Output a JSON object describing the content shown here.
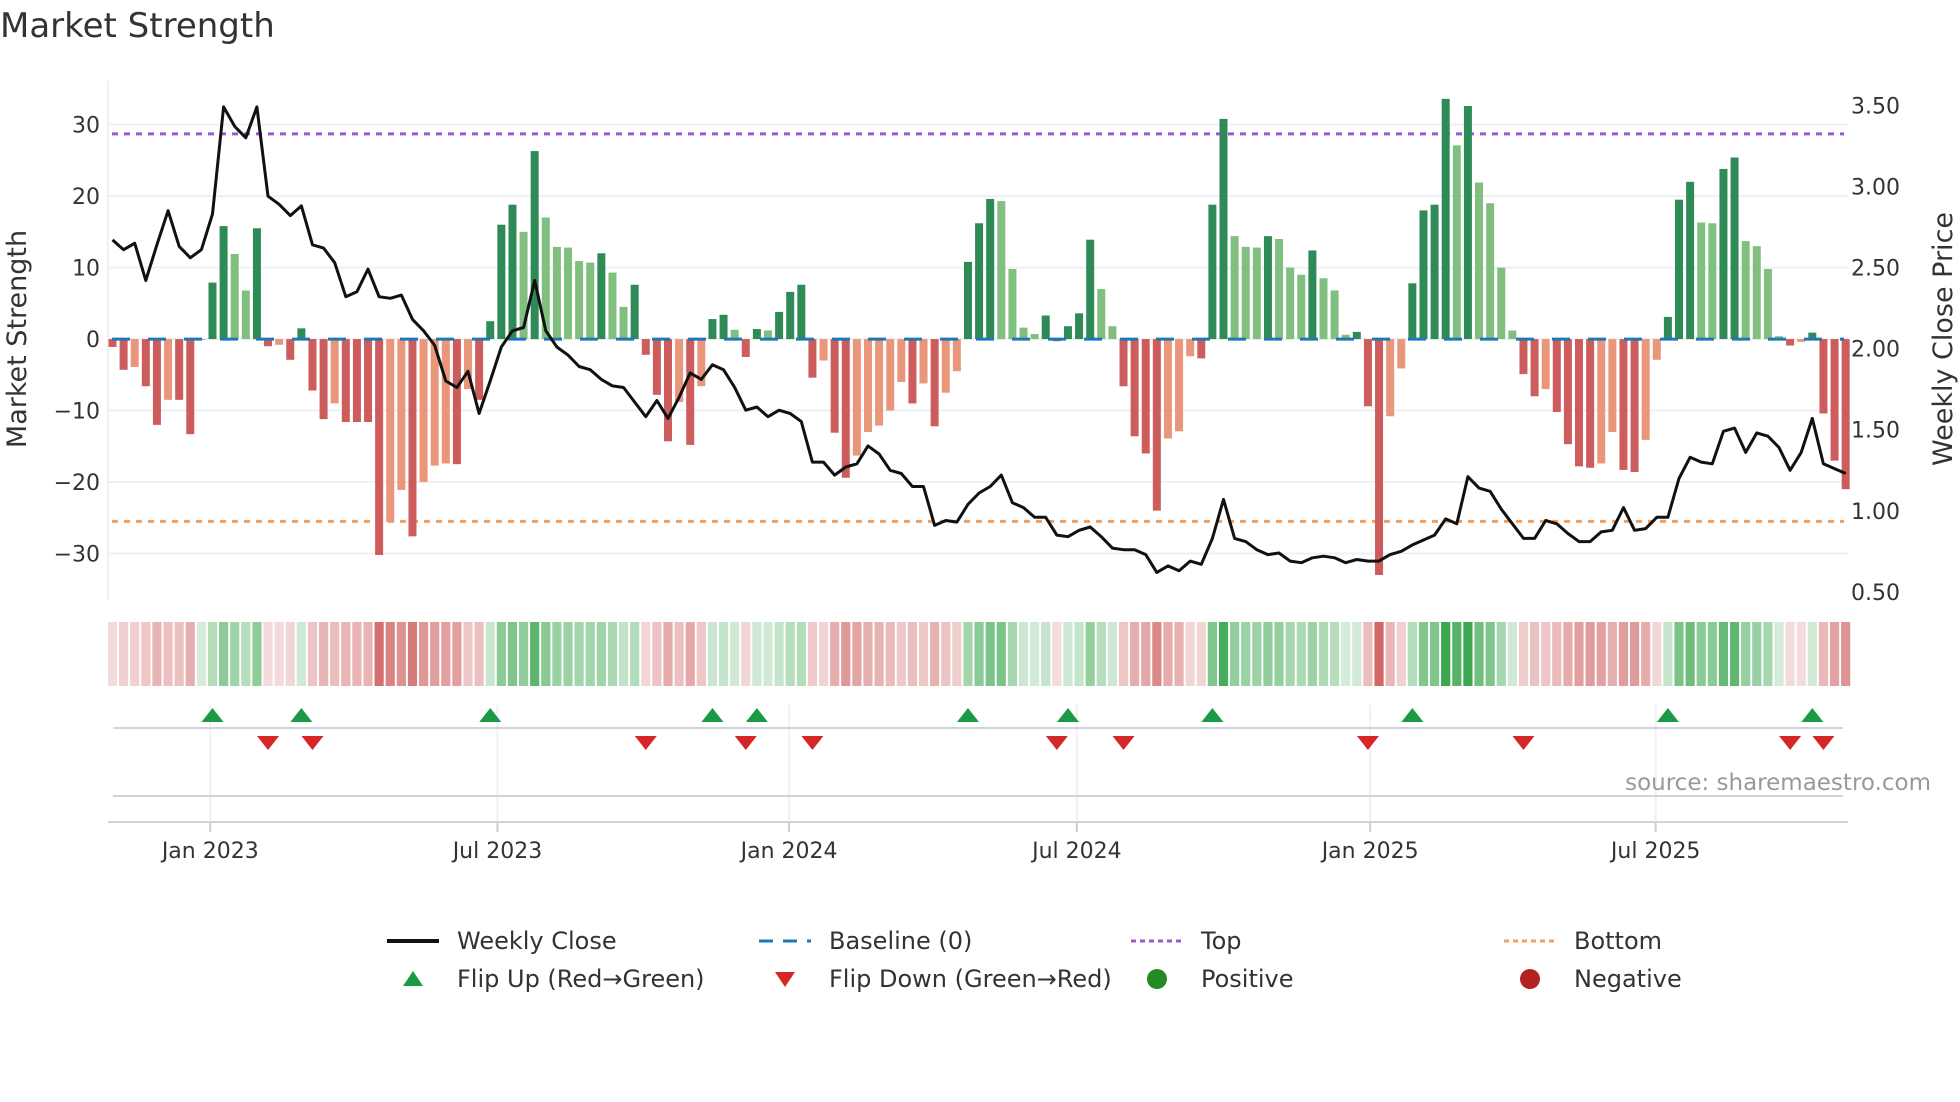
{
  "title": "Market Strength",
  "source": "source: sharemaestro.com",
  "colors": {
    "pos_dark": "#2e8b57",
    "pos_light": "#80bf80",
    "neg_dark": "#cd5c5c",
    "neg_light": "#e9967a",
    "baseline": "#1f77b4",
    "top": "#9b59d0",
    "bottom": "#f0a060",
    "close": "#111111",
    "flip_up": "#1a9a45",
    "flip_down": "#d62728",
    "positive": "#228b22",
    "negative": "#b22222",
    "heat_pos": "46,160,67",
    "heat_neg": "205,92,92"
  },
  "chart_data": {
    "type": "bar+line",
    "title": "Market Strength",
    "ylabel": "Market Strength",
    "y2label": "Weekly Close Price",
    "ylim": [
      -36.5,
      36.1
    ],
    "y2lim": [
      0.45,
      3.65
    ],
    "yticks": [
      "30",
      "20",
      "10",
      "0",
      "−10",
      "−20",
      "−30"
    ],
    "ytick_values": [
      30,
      20,
      10,
      0,
      -10,
      -20,
      -30
    ],
    "y2ticks": [
      "3.50",
      "3.00",
      "2.50",
      "2.00",
      "1.50",
      "1.00",
      "0.50"
    ],
    "y2tick_values": [
      3.5,
      3.0,
      2.5,
      2.0,
      1.5,
      1.0,
      0.5
    ],
    "xticks": [
      {
        "label": "Jan 2023",
        "week": 8.8
      },
      {
        "label": "Jul 2023",
        "week": 34.65
      },
      {
        "label": "Jan 2024",
        "week": 60.9
      },
      {
        "label": "Jul 2024",
        "week": 86.8
      },
      {
        "label": "Jan 2025",
        "week": 113.2
      },
      {
        "label": "Jul 2025",
        "week": 138.9
      }
    ],
    "top_line": 28.7,
    "bottom_line": -25.5,
    "baseline": 0,
    "strength": [
      -1.1,
      -4.3,
      -3.9,
      -6.6,
      -12,
      -8.5,
      -8.5,
      -13.3,
      0,
      7.9,
      15.8,
      11.9,
      6.8,
      15.5,
      -1,
      -0.8,
      -2.9,
      1.5,
      -7.2,
      -11.2,
      -9,
      -11.6,
      -11.6,
      -11.6,
      -30.2,
      -25.6,
      -21.1,
      -27.6,
      -20,
      -17.7,
      -17.4,
      -17.5,
      -7,
      -8.5,
      2.5,
      16,
      18.8,
      15,
      26.3,
      17,
      12.9,
      12.8,
      10.9,
      10.7,
      12,
      9.3,
      4.5,
      7.6,
      -2.2,
      -7.8,
      -14.3,
      -8.8,
      -14.8,
      -6.6,
      2.8,
      3.4,
      1.3,
      -2.5,
      1.4,
      1.2,
      3.8,
      6.6,
      7.6,
      -5.4,
      -3,
      -13.1,
      -19.4,
      -16.3,
      -13,
      -12.1,
      -10,
      -6,
      -9,
      -6.2,
      -12.2,
      -7.5,
      -4.5,
      10.8,
      16.2,
      19.6,
      19.3,
      9.8,
      1.6,
      0.7,
      3.3,
      -0.3,
      1.8,
      3.6,
      13.9,
      7,
      1.8,
      -6.6,
      -13.6,
      -16,
      -24,
      -13.9,
      -12.9,
      -2.4,
      -2.7,
      18.8,
      30.8,
      14.4,
      12.9,
      12.8,
      14.4,
      14,
      10,
      9,
      12.4,
      8.5,
      6.8,
      0.6,
      1,
      -9.4,
      -33,
      -10.8,
      -4.1,
      7.8,
      18,
      18.8,
      33.6,
      27.1,
      32.6,
      21.9,
      19,
      10,
      1.2,
      -4.9,
      -8,
      -7,
      -10.2,
      -14.7,
      -17.8,
      -18,
      -17.4,
      -13,
      -18.3,
      -18.6,
      -14.1,
      -2.9,
      3.1,
      19.5,
      22,
      16.3,
      16.2,
      23.8,
      25.4,
      13.7,
      13,
      9.8,
      0.4,
      -0.9,
      -0.4,
      0.9,
      -10.4,
      -17,
      -21
    ],
    "close": [
      2.67,
      2.61,
      2.65,
      2.42,
      2.64,
      2.85,
      2.63,
      2.56,
      2.61,
      2.83,
      3.49,
      3.37,
      3.3,
      3.49,
      2.94,
      2.89,
      2.82,
      2.88,
      2.64,
      2.62,
      2.53,
      2.32,
      2.35,
      2.49,
      2.32,
      2.31,
      2.33,
      2.18,
      2.11,
      2.02,
      1.8,
      1.76,
      1.86,
      1.6,
      1.8,
      2.01,
      2.11,
      2.13,
      2.42,
      2.11,
      2.01,
      1.96,
      1.89,
      1.87,
      1.81,
      1.77,
      1.76,
      1.67,
      1.58,
      1.68,
      1.57,
      1.7,
      1.85,
      1.81,
      1.9,
      1.87,
      1.76,
      1.62,
      1.64,
      1.58,
      1.62,
      1.6,
      1.55,
      1.3,
      1.3,
      1.22,
      1.27,
      1.29,
      1.4,
      1.35,
      1.25,
      1.23,
      1.15,
      1.15,
      0.91,
      0.94,
      0.93,
      1.04,
      1.11,
      1.15,
      1.22,
      1.05,
      1.02,
      0.96,
      0.96,
      0.85,
      0.84,
      0.88,
      0.9,
      0.84,
      0.77,
      0.76,
      0.76,
      0.73,
      0.62,
      0.66,
      0.63,
      0.69,
      0.67,
      0.83,
      1.07,
      0.83,
      0.81,
      0.76,
      0.73,
      0.74,
      0.69,
      0.68,
      0.71,
      0.72,
      0.71,
      0.68,
      0.7,
      0.69,
      0.69,
      0.73,
      0.75,
      0.79,
      0.82,
      0.85,
      0.95,
      0.92,
      1.21,
      1.14,
      1.12,
      1.01,
      0.92,
      0.83,
      0.83,
      0.94,
      0.92,
      0.86,
      0.81,
      0.81,
      0.87,
      0.88,
      1.02,
      0.88,
      0.89,
      0.96,
      0.96,
      1.2,
      1.33,
      1.3,
      1.29,
      1.49,
      1.51,
      1.36,
      1.48,
      1.46,
      1.39,
      1.25,
      1.36,
      1.57,
      1.29,
      1.26,
      1.23
    ],
    "flip_up_weeks": [
      9,
      17,
      34,
      54,
      58,
      77,
      86,
      99,
      117,
      140,
      153
    ],
    "flip_down_weeks": [
      14,
      18,
      48,
      57,
      63,
      85,
      91,
      113,
      127,
      151,
      154
    ]
  },
  "legend": [
    {
      "label": "Weekly Close",
      "icon": "solid-line"
    },
    {
      "label": "Baseline (0)",
      "icon": "dashed-line"
    },
    {
      "label": "Top",
      "icon": "dotted-line-purple"
    },
    {
      "label": "Bottom",
      "icon": "dotted-line-orange"
    },
    {
      "label": "Flip Up (Red→Green)",
      "icon": "triangle-up"
    },
    {
      "label": "Flip Down (Green→Red)",
      "icon": "triangle-down"
    },
    {
      "label": "Positive",
      "icon": "circle-green"
    },
    {
      "label": "Negative",
      "icon": "circle-red"
    }
  ]
}
